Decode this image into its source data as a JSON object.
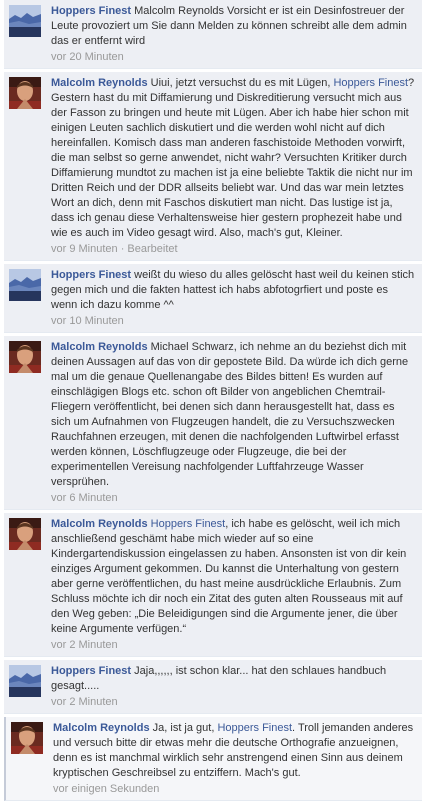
{
  "comments": [
    {
      "author": "Hoppers Finest",
      "avatar": "hoppers-avatar",
      "mention": "",
      "text": "Malcolm Reynolds Vorsicht er ist ein Desinfostreuer der Leute provoziert um Sie dann Melden zu können schreibt alle dem admin das er entfernt wird",
      "time": "vor 20 Minuten",
      "edited": ""
    },
    {
      "author": "Malcolm Reynolds",
      "avatar": "malcolm-avatar",
      "pre_mention": "Uiui, jetzt versuchst du es mit Lügen, ",
      "mention": "Hoppers Finest",
      "text": "? Gestern hast du mit Diffamierung und Diskreditierung versucht mich aus der Fasson zu bringen und heute mit Lügen. Aber ich habe hier schon mit einigen Leuten sachlich diskutiert und die werden wohl nicht auf dich hereinfallen. Komisch dass man anderen faschistoide Methoden vorwirft, die man selbst so gerne anwendet, nicht wahr? Versuchten Kritiker durch Diffamierung mundtot zu machen ist ja eine beliebte Taktik die nicht nur im Dritten Reich und der DDR allseits beliebt war. Und das war mein letztes Wort an dich, denn mit Faschos diskutiert man nicht. Das lustige ist ja, dass ich genau diese Verhaltensweise hier gestern prophezeit habe und wie es auch im Video gesagt wird. Also, mach's gut, Kleiner.",
      "time": "vor 9 Minuten",
      "edited": " · Bearbeitet"
    },
    {
      "author": "Hoppers Finest",
      "avatar": "hoppers-avatar",
      "mention": "",
      "text": "weißt du wieso du alles gelöscht hast weil du keinen stich gegen mich und die fakten hattest ich habs abfotogrfiert und poste es wenn ich dazu komme ^^",
      "time": "vor 10 Minuten",
      "edited": ""
    },
    {
      "author": "Malcolm Reynolds",
      "avatar": "malcolm-avatar",
      "mention": "",
      "text": "Michael Schwarz, ich nehme an du beziehst dich mit deinen Aussagen auf das von dir gepostete Bild. Da würde ich dich gerne mal um die genaue Quellenangabe des Bildes bitten! Es wurden auf einschlägigen Blogs etc. schon oft Bilder von angeblichen Chemtrail-Fliegern veröffentlicht, bei denen sich dann herausgestellt hat, dass es sich um Aufnahmen von Flugzeugen handelt, die zu Versuchszwecken Rauchfahnen erzeugen, mit denen die nachfolgenden Luftwirbel erfasst werden können, Löschflugzeuge oder Flugzeuge, die bei der experimentellen Vereisung nachfolgender Luftfahrzeuge Wasser versprühen.",
      "time": "vor 6 Minuten",
      "edited": ""
    },
    {
      "author": "Malcolm Reynolds",
      "avatar": "malcolm-avatar",
      "pre_mention": "",
      "mention": "Hoppers Finest",
      "text": ", ich habe es gelöscht, weil ich mich anschließend geschämt habe mich wieder auf so eine Kindergartendiskussion eingelassen zu haben. Ansonsten ist von dir kein einziges Argument gekommen. Du kannst die Unterhaltung von gestern aber gerne veröffentlichen, du hast meine ausdrückliche Erlaubnis. Zum Schluss möchte ich dir noch ein Zitat des guten alten Rousseaus mit auf den Weg geben: „Die Beleidigungen sind die Argumente jener, die über keine Argumente verfügen.“",
      "time": "vor 2 Minuten",
      "edited": ""
    },
    {
      "author": "Hoppers Finest",
      "avatar": "hoppers-avatar",
      "mention": "",
      "text": "Jaja,,,,,, ist schon klar... hat den schlaues handbuch gesagt.....",
      "time": "vor 2 Minuten",
      "edited": ""
    },
    {
      "author": "Malcolm Reynolds",
      "avatar": "malcolm-avatar",
      "pre_mention": "Ja, ist ja gut, ",
      "mention": "Hoppers Finest",
      "text": ". Troll jemanden anderes und versuch bitte dir etwas mehr die deutsche Orthografie anzueignen, denn es ist manchmal wirklich sehr anstrengend einen Sinn aus deinem kryptischen Geschreibsel zu entziffern. Mach's gut.",
      "time": "vor einigen Sekunden",
      "edited": ""
    }
  ],
  "colors": {
    "link": "#3b5998",
    "comment_bg": "#edeff4",
    "meta": "#999999"
  }
}
